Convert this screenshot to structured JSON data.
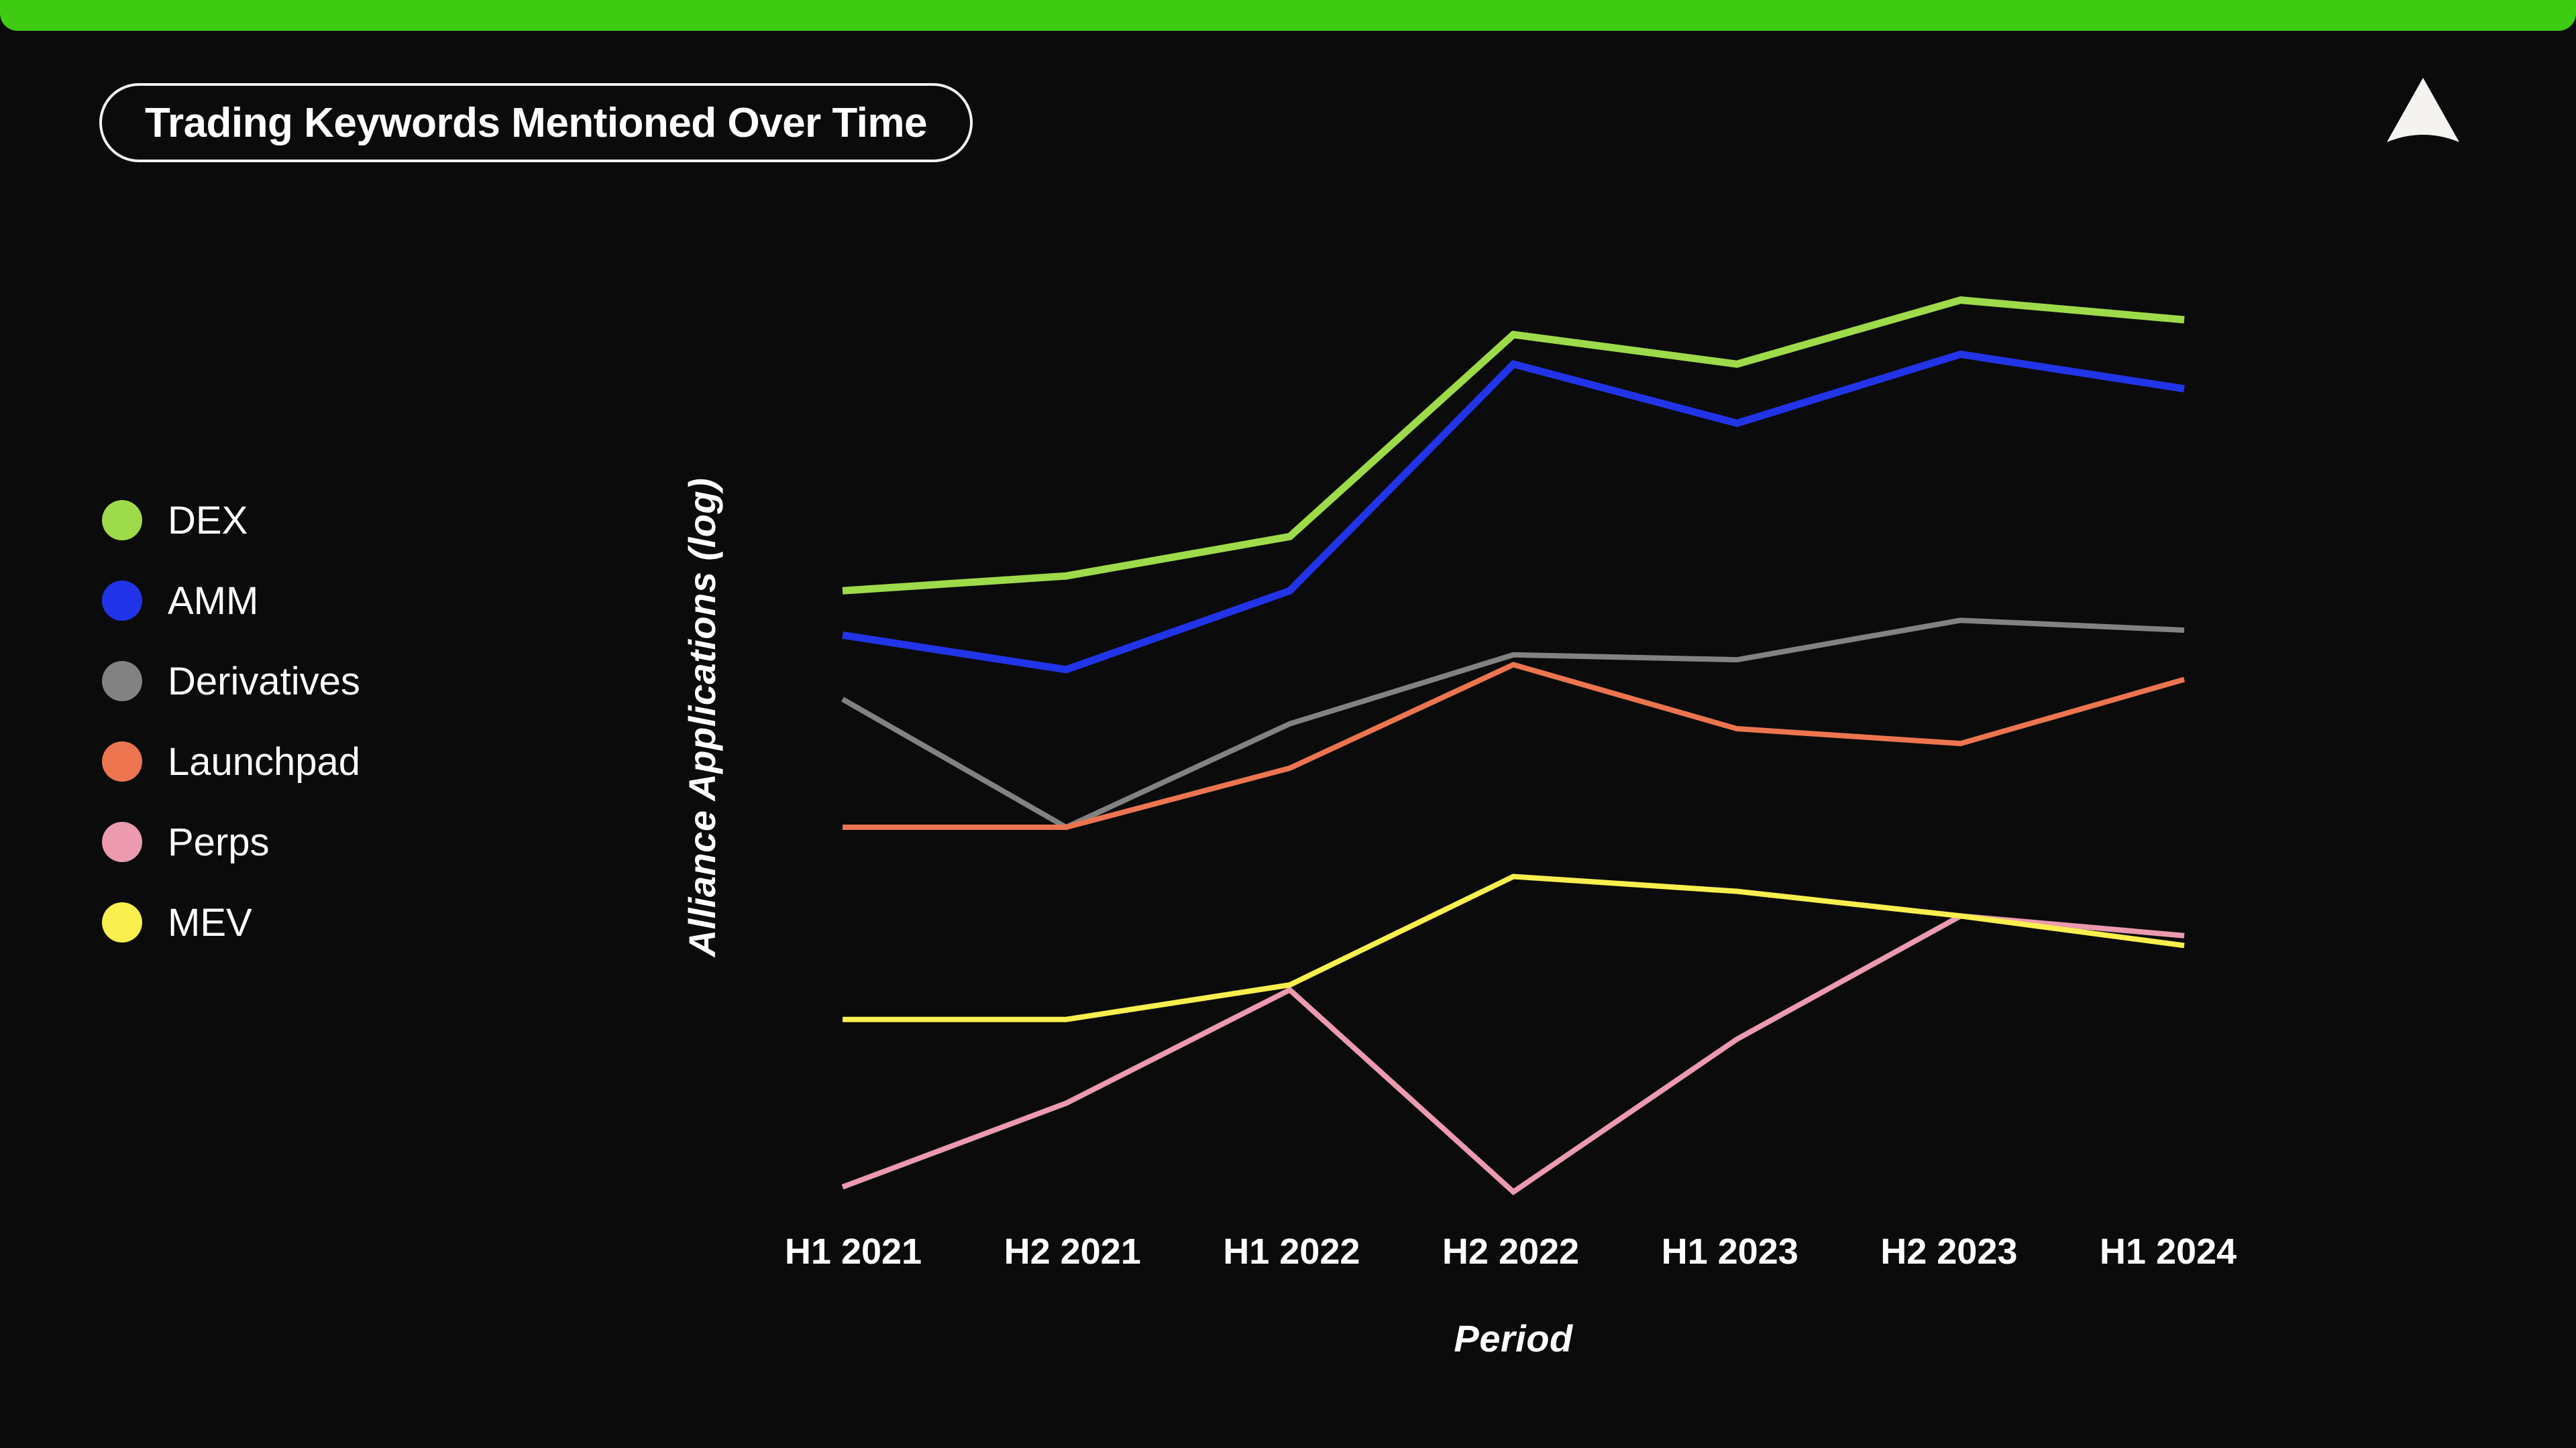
{
  "theme": {
    "background": "#0b0b0b",
    "accent_bar": "#3ecb12",
    "text": "#ffffff"
  },
  "header": {
    "title": "Trading Keywords Mentioned Over Time",
    "logo_name": "alliance-triangle-logo"
  },
  "legend": {
    "position": "left",
    "items": [
      {
        "label": "DEX",
        "color": "#9ddb4a"
      },
      {
        "label": "AMM",
        "color": "#2234e8"
      },
      {
        "label": "Derivatives",
        "color": "#828282"
      },
      {
        "label": "Launchpad",
        "color": "#ec7550"
      },
      {
        "label": "Perps",
        "color": "#eb9aaf"
      },
      {
        "label": "MEV",
        "color": "#f9ef4e"
      }
    ]
  },
  "chart_data": {
    "type": "line",
    "title": "Trading Keywords Mentioned Over Time",
    "xlabel": "Period",
    "ylabel": "Alliance Applications (log)",
    "grid": false,
    "legend_position": "left",
    "x_scale": "categorical",
    "y_scale": "log",
    "axis_ticks_shown": false,
    "categories": [
      "H1 2021",
      "H2 2021",
      "H1 2022",
      "H2 2022",
      "H1 2023",
      "H2 2023",
      "H1 2024"
    ],
    "ylim": [
      0,
      100
    ],
    "series": [
      {
        "name": "DEX",
        "color": "#9ddb4a",
        "values": [
          62.5,
          64.0,
          68.0,
          88.5,
          85.5,
          92.0,
          90.0
        ]
      },
      {
        "name": "AMM",
        "color": "#2234e8",
        "values": [
          58.0,
          54.5,
          62.5,
          85.5,
          79.5,
          86.5,
          83.0
        ]
      },
      {
        "name": "Derivatives",
        "color": "#828282",
        "values": [
          51.5,
          38.5,
          49.0,
          56.0,
          55.5,
          59.5,
          58.5
        ]
      },
      {
        "name": "Launchpad",
        "color": "#ec7550",
        "values": [
          38.5,
          38.5,
          44.5,
          55.0,
          48.5,
          47.0,
          53.5
        ]
      },
      {
        "name": "Perps",
        "color": "#eb9aaf",
        "values": [
          2.0,
          10.5,
          22.0,
          1.5,
          17.0,
          29.5,
          27.5
        ]
      },
      {
        "name": "MEV",
        "color": "#f9ef4e",
        "values": [
          19.0,
          19.0,
          22.5,
          33.5,
          32.0,
          29.5,
          26.5
        ]
      }
    ]
  }
}
